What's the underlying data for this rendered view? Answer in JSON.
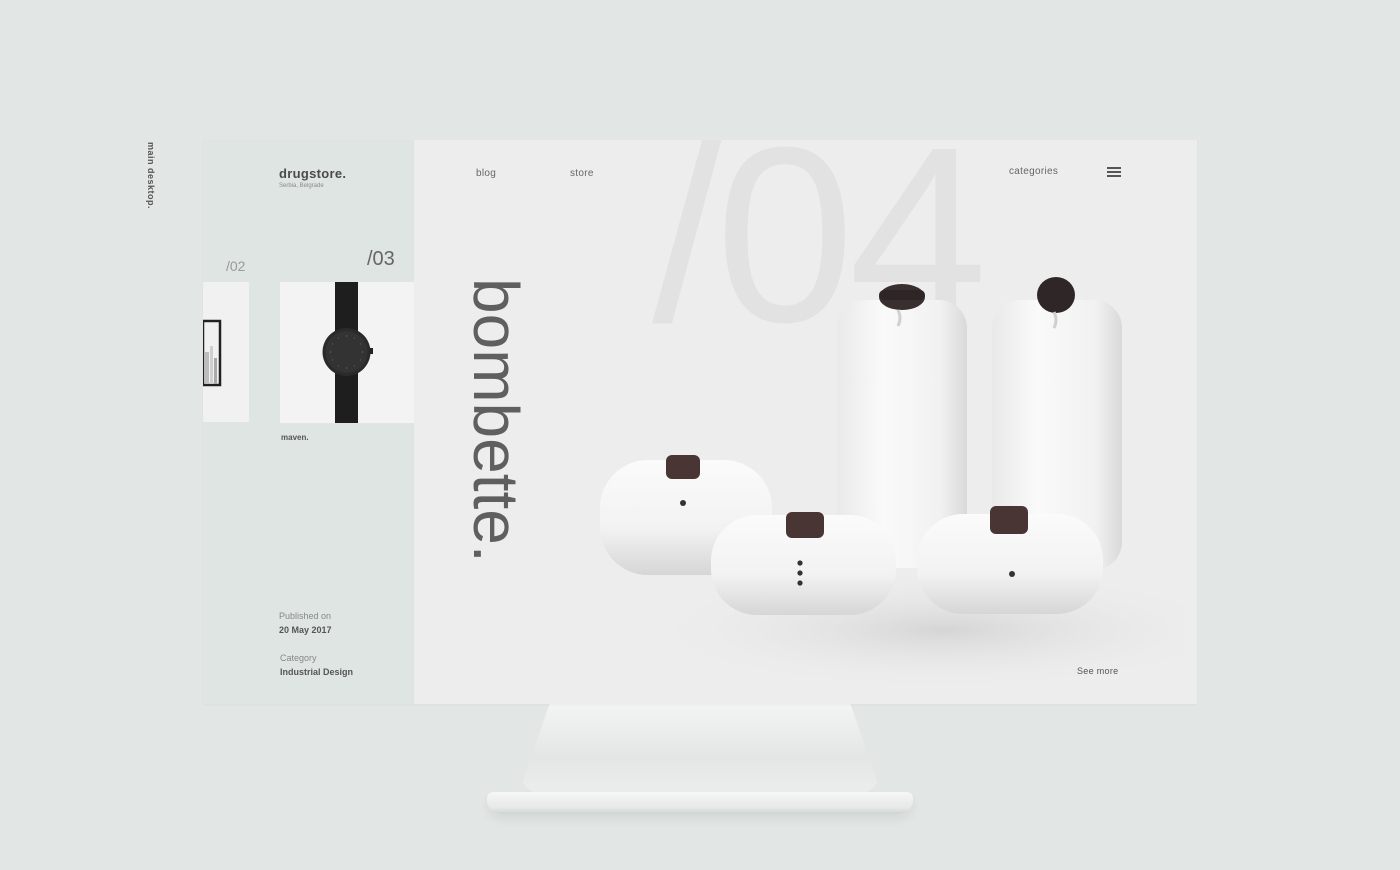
{
  "side_label": "main desktop.",
  "brand": {
    "name": "drugstore.",
    "location": "Serbia, Belgrade"
  },
  "nav": {
    "blog": "blog",
    "store": "store",
    "categories": "categories"
  },
  "sidebar": {
    "prev_index": "/02",
    "current_index": "/03",
    "current_title": "maven.",
    "published_label": "Published on",
    "published_date": "20 May 2017",
    "category_label": "Category",
    "category_value": "Industrial Design"
  },
  "hero": {
    "big_index": "/04",
    "title": "bombette.",
    "see_more": "See more"
  },
  "icons": {
    "menu": "hamburger-menu-icon"
  },
  "colors": {
    "background": "#e2e7e5",
    "sidebar": "#dfe5e2",
    "main": "#ededed",
    "text": "#555555"
  }
}
